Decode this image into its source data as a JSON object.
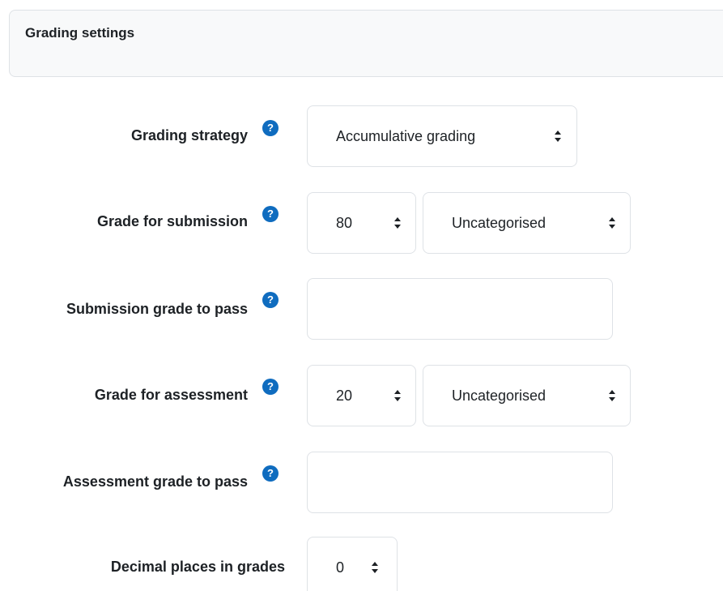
{
  "section": {
    "title": "Grading settings"
  },
  "fields": {
    "grading_strategy": {
      "label": "Grading strategy",
      "help": "?",
      "value": "Accumulative grading"
    },
    "grade_for_submission": {
      "label": "Grade for submission",
      "help": "?",
      "value": "80",
      "category": "Uncategorised"
    },
    "submission_grade_to_pass": {
      "label": "Submission grade to pass",
      "help": "?",
      "value": ""
    },
    "grade_for_assessment": {
      "label": "Grade for assessment",
      "help": "?",
      "value": "20",
      "category": "Uncategorised"
    },
    "assessment_grade_to_pass": {
      "label": "Assessment grade to pass",
      "help": "?",
      "value": ""
    },
    "decimal_places": {
      "label": "Decimal places in grades",
      "value": "0"
    }
  },
  "icons": {
    "help": "question-circle-icon",
    "select_caret": "sort-caret-icon"
  },
  "colors": {
    "accent": "#0f6cbf",
    "header_bg": "#f8f9fa",
    "border": "#dee2e6",
    "text": "#1d2125"
  }
}
